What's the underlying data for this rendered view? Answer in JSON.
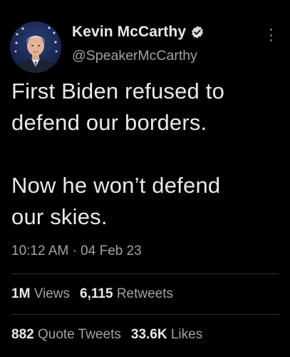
{
  "author": {
    "display_name": "Kevin McCarthy",
    "handle": "@SpeakerMcCarthy",
    "verified": true,
    "avatar_icon": "profile-photo"
  },
  "tweet": {
    "line1": "First Biden refused to",
    "line2": "defend our borders.",
    "line3": "Now he won’t defend",
    "line4": "our skies."
  },
  "meta": {
    "time": "10:12 AM",
    "separator": "·",
    "date": "04 Feb 23"
  },
  "stats": {
    "views_count": "1M",
    "views_label": "Views",
    "retweets_count": "6,115",
    "retweets_label": "Retweets",
    "quote_count": "882",
    "quote_label": "Quote Tweets",
    "likes_count": "33.6K",
    "likes_label": "Likes"
  },
  "colors": {
    "background": "#000000",
    "primary_text": "#e7e9ea",
    "secondary_text": "#9ca3a8",
    "verified_badge": "#1d9bf0"
  },
  "icons": {
    "more": "more-options-icon",
    "verified": "verified-badge-icon"
  }
}
